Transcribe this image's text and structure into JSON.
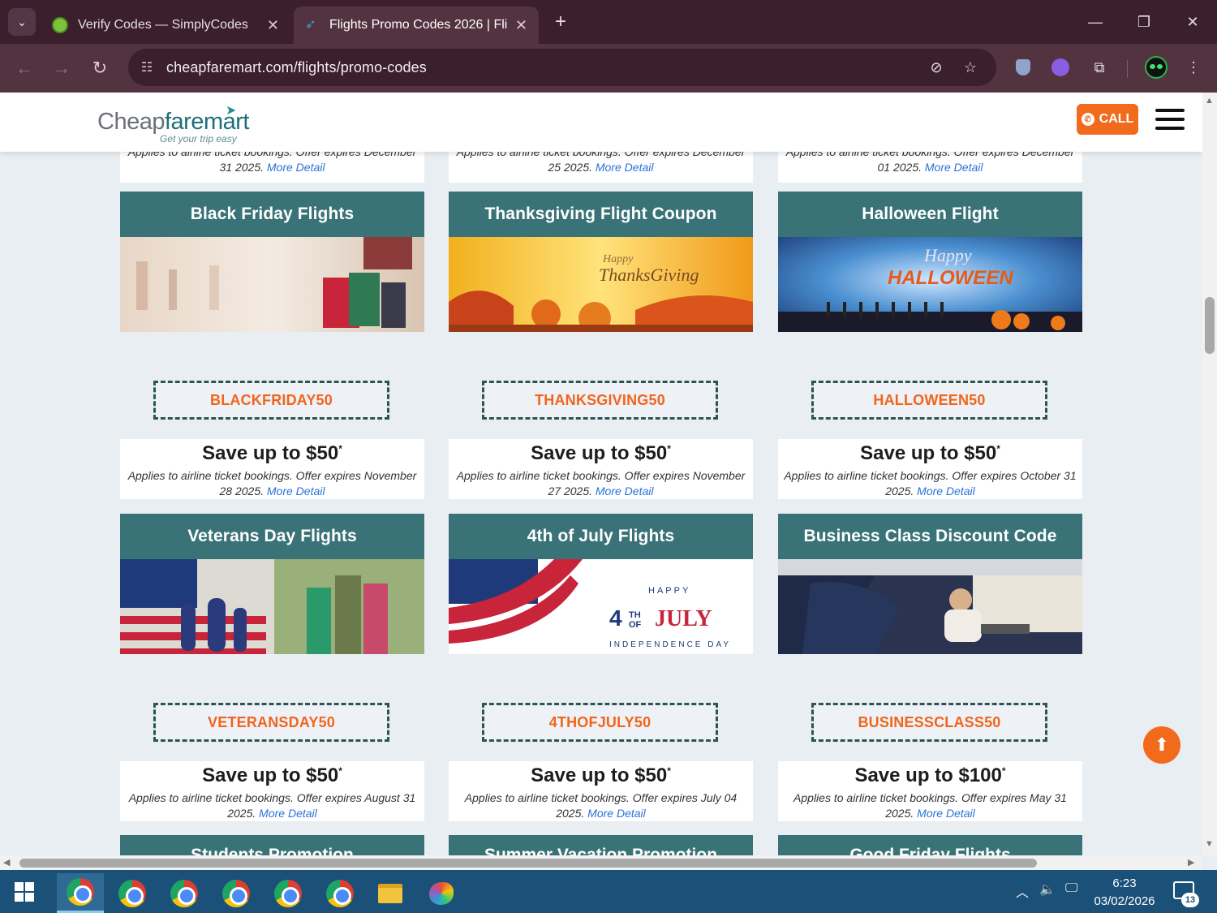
{
  "browser": {
    "tabs": [
      {
        "title": "Verify Codes — SimplyCodes",
        "active": false,
        "icon": "simplycodes-icon"
      },
      {
        "title": "Flights Promo Codes 2026 | Flig",
        "active": true,
        "icon": "cheapfaremart-plane-icon"
      }
    ],
    "url": "cheapfaremart.com/flights/promo-codes"
  },
  "site": {
    "logo": {
      "part1": "Cheap",
      "part2": "faremart",
      "tagline": "Get your trip easy"
    },
    "call_label": "CALL",
    "colors": {
      "teal": "#3a7377",
      "orange": "#f26a1b",
      "link": "#2a73d8"
    }
  },
  "partial_top": [
    {
      "fine": "Applies to airline ticket bookings. Offer expires December",
      "expiry": "31 2025.",
      "more": "More Detail"
    },
    {
      "fine": "Applies to airline ticket bookings. Offer expires December",
      "expiry": "25 2025.",
      "more": "More Detail"
    },
    {
      "fine": "Applies to airline ticket bookings. Offer expires December",
      "expiry": "01 2025.",
      "more": "More Detail"
    }
  ],
  "cards": [
    {
      "title": "Black Friday Flights",
      "code": "BLACKFRIDAY50",
      "save": "Save up to $50",
      "star": "*",
      "fine": "Applies to airline ticket bookings. Offer expires November 28 2025.",
      "more": "More Detail",
      "image": "black-friday-shopping-bags"
    },
    {
      "title": "Thanksgiving Flight Coupon",
      "code": "THANKSGIVING50",
      "save": "Save up to $50",
      "star": "*",
      "fine": "Applies to airline ticket bookings. Offer expires November 27 2025.",
      "more": "More Detail",
      "image": "thanksgiving-autumn-pumpkins",
      "image_text": [
        "Happy",
        "ThanksGiving"
      ]
    },
    {
      "title": "Halloween Flight",
      "code": "HALLOWEEN50",
      "save": "Save up to $50",
      "star": "*",
      "fine": "Applies to airline ticket bookings. Offer expires October 31 2025.",
      "more": "More Detail",
      "image": "happy-halloween-night",
      "image_text": [
        "Happy",
        "HALLOWEEN"
      ]
    },
    {
      "title": "Veterans Day Flights",
      "code": "VETERANSDAY50",
      "save": "Save up to $50",
      "star": "*",
      "fine": "Applies to airline ticket bookings. Offer expires August 31 2025.",
      "more": "More Detail",
      "image": "veterans-flag-family"
    },
    {
      "title": "4th of July Flights",
      "code": "4THOFJULY50",
      "save": "Save up to $50",
      "star": "*",
      "fine": "Applies to airline ticket bookings. Offer expires July 04 2025.",
      "more": "More Detail",
      "image": "fourth-of-july-flag",
      "image_text": [
        "HAPPY",
        "4",
        "TH",
        "OF",
        "JULY",
        "INDEPENDENCE DAY"
      ]
    },
    {
      "title": "Business Class Discount Code",
      "code": "BUSINESSCLASS50",
      "save": "Save up to $100",
      "star": "*",
      "fine": "Applies to airline ticket bookings. Offer expires May 31 2025.",
      "more": "More Detail",
      "image": "business-class-cabin"
    }
  ],
  "partial_bottom": [
    "Students Promotion",
    "Summer Vacation Promotion",
    "Good Friday Flights"
  ],
  "taskbar": {
    "time": "6:23",
    "date": "03/02/2026",
    "notifications": "13"
  }
}
